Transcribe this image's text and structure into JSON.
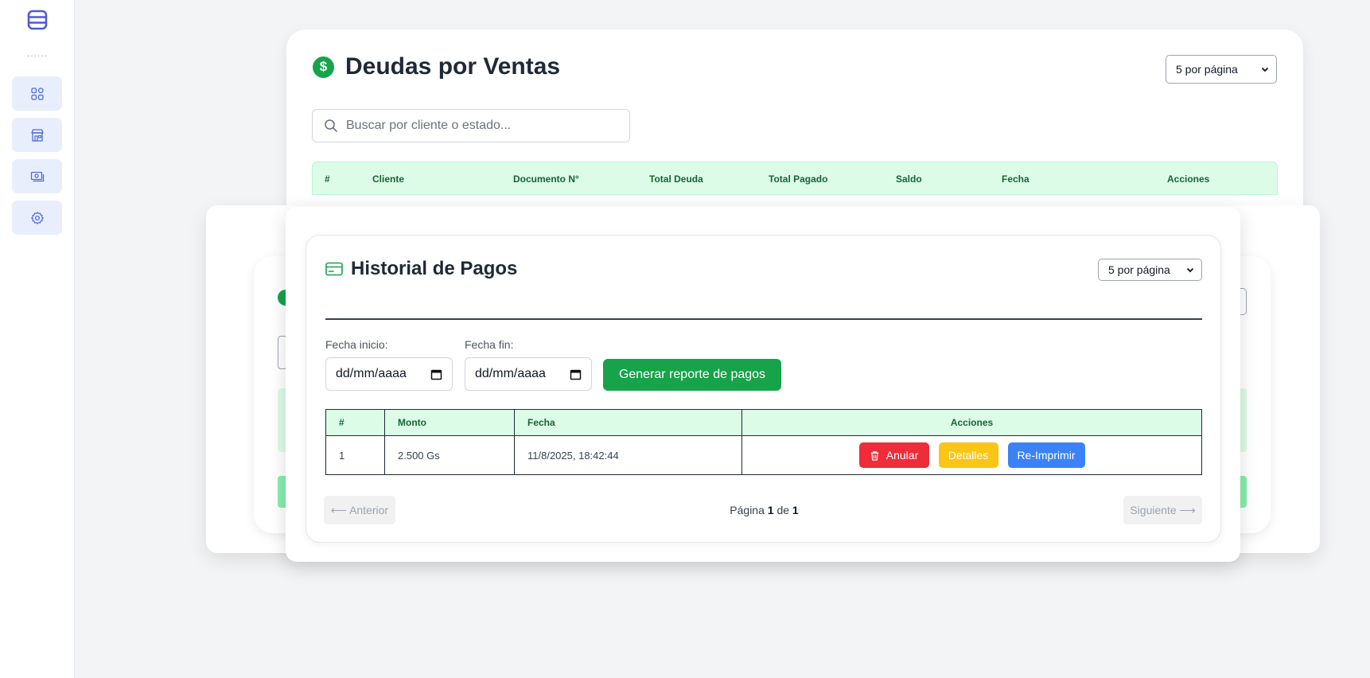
{
  "sidebar": {
    "logo_icon": "database-stack-icon",
    "separator": "......",
    "items": [
      {
        "icon": "grid-icon"
      },
      {
        "icon": "store-icon"
      },
      {
        "icon": "money-icon"
      },
      {
        "icon": "gear-icon"
      }
    ]
  },
  "debts": {
    "title": "Deudas por Ventas",
    "per_page": "5 por página",
    "search_placeholder": "Buscar por cliente o estado...",
    "columns": [
      "#",
      "Cliente",
      "Documento N°",
      "Total Deuda",
      "Total Pagado",
      "Saldo",
      "Fecha",
      "Acciones"
    ]
  },
  "payments": {
    "title": "Historial de Pagos",
    "per_page": "5 por página",
    "start_label": "Fecha inicio:",
    "end_label": "Fecha fin:",
    "date_placeholder": "dd/mm/aaaa",
    "report_button": "Generar reporte de pagos",
    "columns": [
      "#",
      "Monto",
      "Fecha",
      "Acciones"
    ],
    "rows": [
      {
        "num": "1",
        "amount": "2.500 Gs",
        "date": "11/8/2025, 18:42:44"
      }
    ],
    "actions": {
      "void": "Anular",
      "details": "Detalles",
      "reprint": "Re-Imprimir"
    },
    "pager": {
      "prev": "⟵ Anterior",
      "next": "Siguiente ⟶",
      "page_word": "Página",
      "of_word": "de",
      "current": "1",
      "total": "1"
    }
  },
  "colors": {
    "accent_green": "#16a34a",
    "header_green": "#dcfce7",
    "danger": "#ef2d3a",
    "warning": "#fac515",
    "primary": "#3b82f6"
  }
}
